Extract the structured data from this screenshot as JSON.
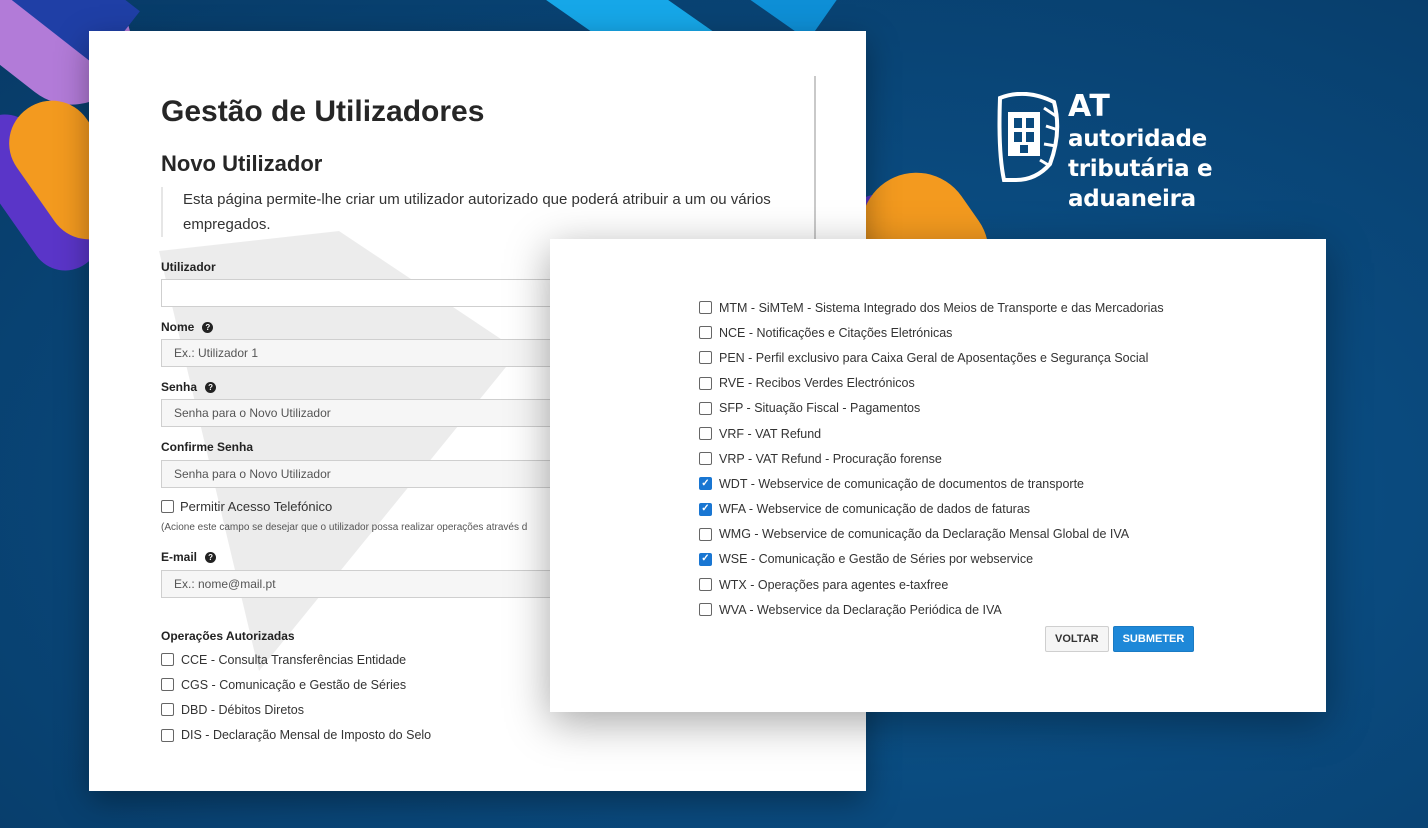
{
  "brand": {
    "at": "AT",
    "line1": "autoridade",
    "line2": "tributária e aduaneira"
  },
  "page": {
    "title": "Gestão de Utilizadores",
    "subtitle": "Novo Utilizador",
    "intro": "Esta página permite-lhe criar um utilizador autorizado que poderá atribuir a um ou vários empregados."
  },
  "form": {
    "utilizador": {
      "label": "Utilizador",
      "value": ""
    },
    "nome": {
      "label": "Nome",
      "placeholder": "Ex.: Utilizador 1"
    },
    "senha": {
      "label": "Senha",
      "placeholder": "Senha para o Novo Utilizador"
    },
    "confirme": {
      "label": "Confirme Senha",
      "placeholder": "Senha para o Novo Utilizador"
    },
    "telefone": {
      "label": "Permitir Acesso Telefónico",
      "checked": false
    },
    "telefone_note": "(Acione este campo se desejar que o utilizador possa realizar operações através d",
    "email": {
      "label": "E-mail",
      "placeholder": "Ex.: nome@mail.pt"
    },
    "help_glyph": "?"
  },
  "operacoes": {
    "label": "Operações Autorizadas",
    "left_items": [
      {
        "label": "CCE - Consulta Transferências Entidade",
        "checked": false
      },
      {
        "label": "CGS - Comunicação e Gestão de Séries",
        "checked": false
      },
      {
        "label": "DBD - Débitos Diretos",
        "checked": false
      },
      {
        "label": "DIS - Declaração Mensal de Imposto do Selo",
        "checked": false
      }
    ],
    "right_items": [
      {
        "label": "MTM - SiMTeM - Sistema Integrado dos Meios de Transporte e das Mercadorias",
        "checked": false
      },
      {
        "label": "NCE - Notificações e Citações Eletrónicas",
        "checked": false
      },
      {
        "label": "PEN - Perfil exclusivo para Caixa Geral de Aposentações e Segurança Social",
        "checked": false
      },
      {
        "label": "RVE - Recibos Verdes Electrónicos",
        "checked": false
      },
      {
        "label": "SFP - Situação Fiscal - Pagamentos",
        "checked": false
      },
      {
        "label": "VRF - VAT Refund",
        "checked": false
      },
      {
        "label": "VRP - VAT Refund - Procuração forense",
        "checked": false
      },
      {
        "label": "WDT - Webservice de comunicação de documentos de transporte",
        "checked": true
      },
      {
        "label": "WFA - Webservice de comunicação de dados de faturas",
        "checked": true
      },
      {
        "label": "WMG - Webservice de comunicação da Declaração Mensal Global de IVA",
        "checked": false
      },
      {
        "label": "WSE - Comunicação e Gestão de Séries por webservice",
        "checked": true
      },
      {
        "label": "WTX - Operações para agentes e-taxfree",
        "checked": false
      },
      {
        "label": "WVA - Webservice da Declaração Periódica de IVA",
        "checked": false
      }
    ]
  },
  "actions": {
    "back": "VOLTAR",
    "submit": "SUBMETER"
  },
  "colors": {
    "accent": "#1e88d8",
    "checkbox_checked": "#1976d2",
    "orange": "#f39a1f",
    "purple": "#5a35c8"
  }
}
